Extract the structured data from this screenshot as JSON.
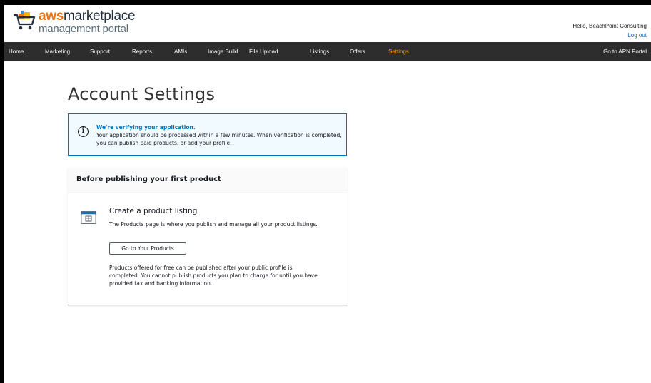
{
  "header": {
    "brand_aws": "aws",
    "brand_marketplace": "marketplace",
    "brand_sub": "management portal",
    "greeting": "Hello, BeachPoint Consulting",
    "logout": "Log out"
  },
  "nav": {
    "items": [
      {
        "label": "Home"
      },
      {
        "label": "Marketing"
      },
      {
        "label": "Support"
      },
      {
        "label": "Reports"
      },
      {
        "label": "AMIs"
      },
      {
        "label": "Image Build"
      },
      {
        "label": "File Upload"
      },
      {
        "label": "Listings"
      },
      {
        "label": "Offers"
      },
      {
        "label": "Settings",
        "active": true
      }
    ],
    "apn_portal": "Go to APN Portal"
  },
  "page": {
    "title": "Account Settings"
  },
  "alert": {
    "icon": "info-icon",
    "heading": "We're verifying your application.",
    "body": "Your application should be processed within a few minutes. When verification is completed, you can publish paid products, or add your profile."
  },
  "card": {
    "heading": "Before publishing your first product",
    "icon": "browser-window-icon",
    "item_title": "Create a product listing",
    "item_desc": "The Products page is where you publish and manage all your product listings.",
    "button_label": "Go to Your Products",
    "note": "Products offered for free can be published after your public profile is completed. You cannot publish products you plan to charge for until you have provided tax and banking information."
  },
  "colors": {
    "nav_bg": "#2d2d2d",
    "active_nav": "#ff9900",
    "aws_orange": "#ec7211",
    "alert_border": "#0073bb",
    "alert_bg": "#f1faff",
    "link": "#1166bb"
  }
}
